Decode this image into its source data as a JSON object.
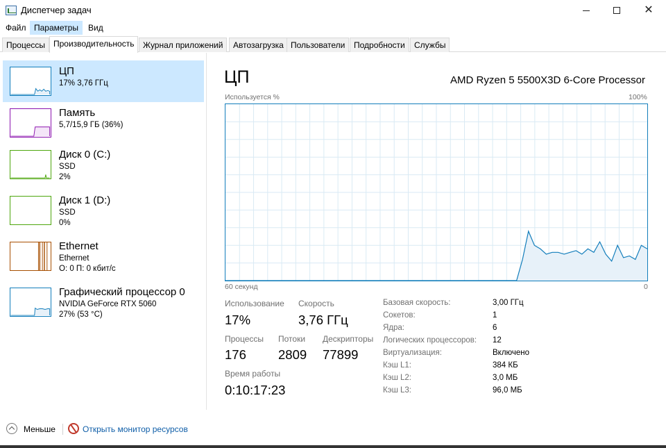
{
  "window": {
    "title": "Диспетчер задач"
  },
  "menu": [
    "Файл",
    "Параметры",
    "Вид"
  ],
  "tabs": [
    "Процессы",
    "Производительность",
    "Журнал приложений",
    "Автозагрузка",
    "Пользователи",
    "Подробности",
    "Службы"
  ],
  "active_tab_index": 1,
  "resources": [
    {
      "name": "ЦП",
      "line1": "17% 3,76 ГГц",
      "line2": "",
      "color": "#117dbb"
    },
    {
      "name": "Память",
      "line1": "5,7/15,9 ГБ (36%)",
      "line2": "",
      "color": "#8b12ae"
    },
    {
      "name": "Диск 0 (C:)",
      "line1": "SSD",
      "line2": "2%",
      "color": "#4da60c"
    },
    {
      "name": "Диск 1 (D:)",
      "line1": "SSD",
      "line2": "0%",
      "color": "#4da60c"
    },
    {
      "name": "Ethernet",
      "line1": "Ethernet",
      "line2": "О: 0 П: 0 кбит/с",
      "color": "#a74f01"
    },
    {
      "name": "Графический процессор 0",
      "line1": "NVIDIA GeForce RTX 5060",
      "line2": "27% (53 °C)",
      "color": "#117dbb"
    }
  ],
  "main": {
    "title": "ЦП",
    "model": "AMD Ryzen 5 5500X3D 6-Core Processor",
    "graph_label_left": "Используется %",
    "graph_label_right": "100%",
    "graph_x_left": "60 секунд",
    "graph_x_right": "0",
    "cpu_usage_history_percent": [
      0,
      0,
      0,
      0,
      0,
      0,
      0,
      0,
      0,
      0,
      0,
      0,
      0,
      0,
      0,
      0,
      0,
      0,
      0,
      0,
      0,
      0,
      0,
      0,
      0,
      0,
      0,
      0,
      0,
      0,
      0,
      0,
      0,
      0,
      0,
      0,
      0,
      0,
      0,
      0,
      0,
      0,
      0,
      0,
      0,
      0,
      0,
      0,
      0,
      0,
      12,
      28,
      20,
      18,
      15,
      16,
      16,
      15,
      16,
      17,
      15,
      18,
      16,
      22,
      15,
      11,
      20,
      13,
      14,
      12,
      20,
      18
    ]
  },
  "stats": {
    "usage_label": "Использование",
    "usage_value": "17%",
    "speed_label": "Скорость",
    "speed_value": "3,76 ГГц",
    "processes_label": "Процессы",
    "processes_value": "176",
    "threads_label": "Потоки",
    "threads_value": "2809",
    "handles_label": "Дескрипторы",
    "handles_value": "77899",
    "uptime_label": "Время работы",
    "uptime_value": "0:10:17:23"
  },
  "specs": [
    {
      "label": "Базовая скорость:",
      "value": "3,00 ГГц"
    },
    {
      "label": "Сокетов:",
      "value": "1"
    },
    {
      "label": "Ядра:",
      "value": "6"
    },
    {
      "label": "Логических процессоров:",
      "value": "12"
    },
    {
      "label": "Виртуализация:",
      "value": "Включено"
    },
    {
      "label": "Кэш L1:",
      "value": "384 КБ"
    },
    {
      "label": "Кэш L2:",
      "value": "3,0 МБ"
    },
    {
      "label": "Кэш L3:",
      "value": "96,0 МБ"
    }
  ],
  "footer": {
    "fewer_label": "Меньше",
    "monitor_label": "Открыть монитор ресурсов"
  },
  "colors": {
    "accent": "#117dbb",
    "selection": "#cce8ff",
    "link": "#0f5ea8"
  }
}
